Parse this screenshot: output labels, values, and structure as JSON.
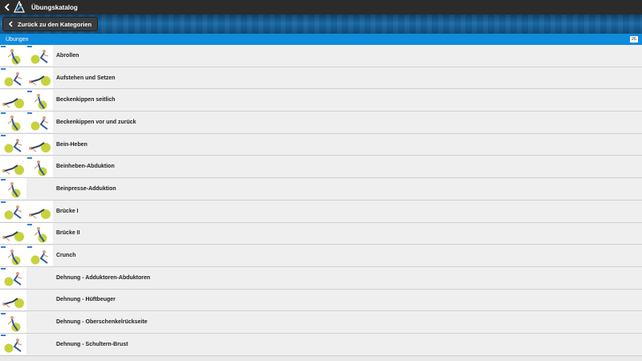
{
  "topbar": {
    "title": "Übungskatalog",
    "back_icon": "chevron-left-icon",
    "logo_icon": "app-logo-icon"
  },
  "hero": {
    "back_button_label": "Zurück zu den Kategorien"
  },
  "section": {
    "title": "Übungen",
    "count": "26"
  },
  "colors": {
    "topbar": "#2b2b2b",
    "hero": "#1a6ca6",
    "section_header": "#0f8bdc",
    "row_bg": "#efefef",
    "ball": "#c8d23c"
  },
  "exercises": [
    {
      "label": "Abrollen",
      "thumbs": 2
    },
    {
      "label": "Aufstehen und Setzen",
      "thumbs": 2
    },
    {
      "label": "Beckenkippen seitlich",
      "thumbs": 2
    },
    {
      "label": "Beckenkippen vor und zurück",
      "thumbs": 2
    },
    {
      "label": "Bein-Heben",
      "thumbs": 2
    },
    {
      "label": "Beinheben-Abduktion",
      "thumbs": 2
    },
    {
      "label": "Beinpresse-Adduktion",
      "thumbs": 1
    },
    {
      "label": "Brücke I",
      "thumbs": 2
    },
    {
      "label": "Brücke II",
      "thumbs": 2
    },
    {
      "label": "Crunch",
      "thumbs": 2
    },
    {
      "label": "Dehnung - Adduktoren-Abduktoren",
      "thumbs": 1
    },
    {
      "label": "Dehnung - Hüftbeuger",
      "thumbs": 1
    },
    {
      "label": "Dehnung - Oberschenkelrückseite",
      "thumbs": 1
    },
    {
      "label": "Dehnung - Schultern-Brust",
      "thumbs": 1
    }
  ]
}
